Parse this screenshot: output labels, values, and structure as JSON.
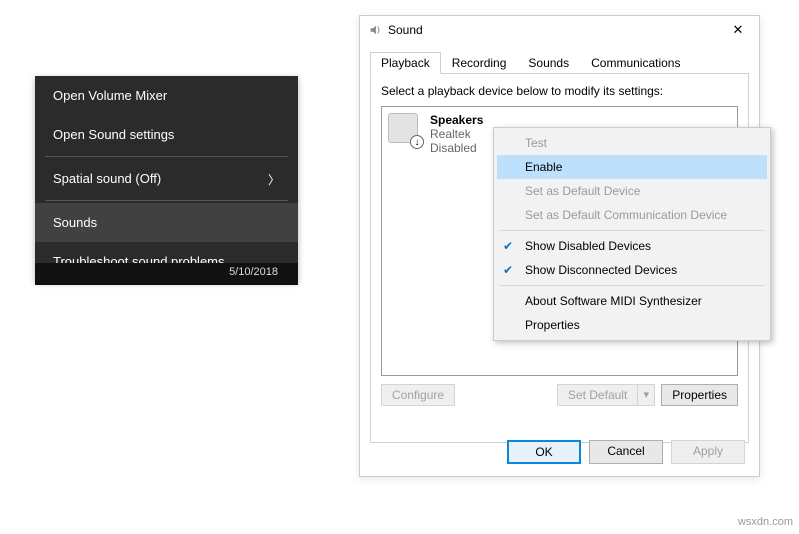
{
  "dark_menu": {
    "items": [
      {
        "label": "Open Volume Mixer"
      },
      {
        "label": "Open Sound settings"
      },
      {
        "label": "Spatial sound (Off)",
        "has_submenu": true
      },
      {
        "label": "Sounds",
        "hover": true
      },
      {
        "label": "Troubleshoot sound problems"
      }
    ],
    "date": "5/10/2018"
  },
  "sound_dialog": {
    "title": "Sound",
    "tabs": [
      "Playback",
      "Recording",
      "Sounds",
      "Communications"
    ],
    "instruction": "Select a playback device below to modify its settings:",
    "device": {
      "name": "Speakers",
      "driver": "Realtek",
      "state": "Disabled"
    },
    "buttons": {
      "configure": "Configure",
      "set_default": "Set Default",
      "properties": "Properties",
      "ok": "OK",
      "cancel": "Cancel",
      "apply": "Apply"
    }
  },
  "context_menu": {
    "items": {
      "test": "Test",
      "enable": "Enable",
      "set_default": "Set as Default Device",
      "set_comm": "Set as Default Communication Device",
      "show_disabled": "Show Disabled Devices",
      "show_disconnected": "Show Disconnected Devices",
      "about": "About Software MIDI Synthesizer",
      "properties": "Properties"
    }
  },
  "watermark": "wsxdn.com"
}
